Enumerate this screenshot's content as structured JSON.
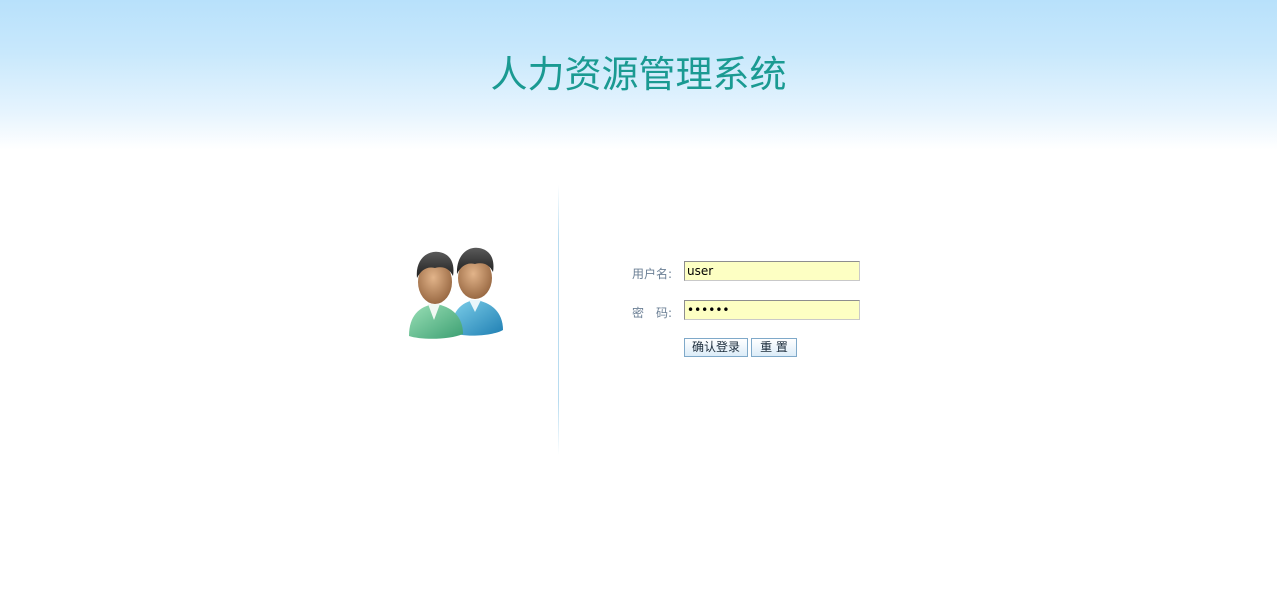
{
  "header": {
    "title": "人力资源管理系统"
  },
  "login_form": {
    "username_label": "用户名:",
    "username_value": "user",
    "password_label": "密　码:",
    "password_value": "••••••",
    "login_button": "确认登录",
    "reset_button": "重 置"
  },
  "icons": {
    "users_icon": "users-icon"
  },
  "colors": {
    "title": "#1a9a92",
    "header_top": "#b8e1fb",
    "input_background": "#fdffc3",
    "label": "#6b7f95"
  }
}
